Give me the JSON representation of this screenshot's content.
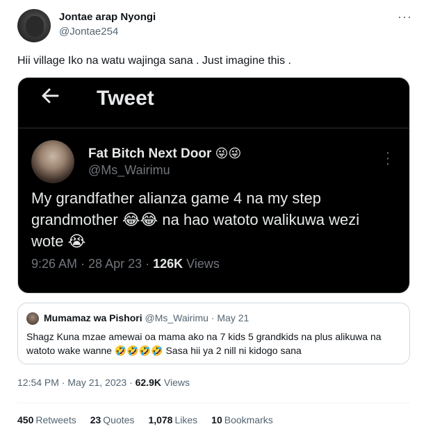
{
  "author": {
    "name": "Jontae arap Nyongi",
    "handle": "@Jontae254",
    "more_icon": "more-horizontal-icon"
  },
  "tweet": {
    "text": "Hii village Iko na watu wajinga sana . Just imagine this ."
  },
  "media": {
    "header_back_icon": "arrow-left-icon",
    "header_title": "Tweet",
    "inner": {
      "name": "Fat Bitch Next Door",
      "name_emoji": "😜😜",
      "handle": "@Ms_Wairimu",
      "more_icon": "more-vertical-icon",
      "text": "My grandfather alianza game 4 na my step grandmother 😂😂 na hao watoto walikuwa wezi wote 😭",
      "time": "9:26 AM · 28 Apr 23 · ",
      "views_count": "126K",
      "views_label": " Views"
    }
  },
  "quote": {
    "name": "Mumamaz wa Pishori",
    "meta": "@Ms_Wairimu · May 21",
    "text": "Shagz Kuna mzae amewai oa mama ako na 7 kids 5 grandkids na plus alikuwa na watoto wake wanne 🤣🤣🤣🤣 Sasa hii ya 2 nill ni kidogo sana"
  },
  "timestamp": {
    "time": "12:54 PM · May 21, 2023 · ",
    "views_count": "62.9K",
    "views_label": " Views"
  },
  "stats": {
    "retweets_count": "450",
    "retweets_label": "Retweets",
    "quotes_count": "23",
    "quotes_label": "Quotes",
    "likes_count": "1,078",
    "likes_label": "Likes",
    "bookmarks_count": "10",
    "bookmarks_label": "Bookmarks"
  }
}
